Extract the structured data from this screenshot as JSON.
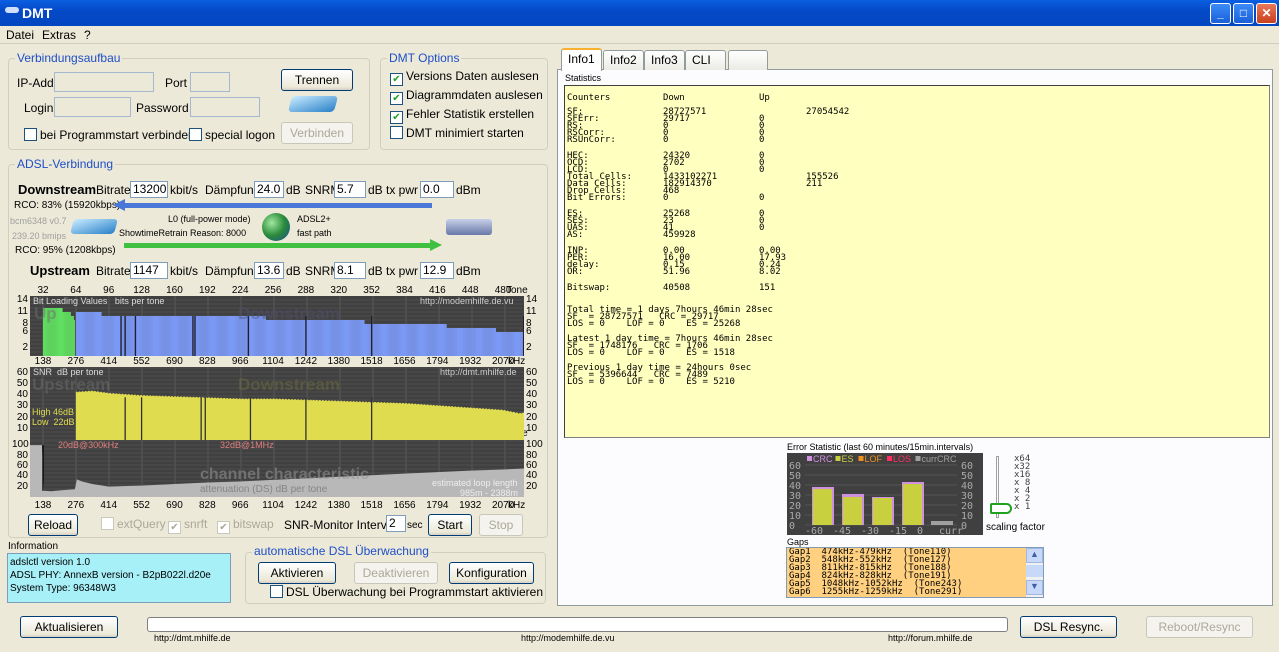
{
  "window": {
    "title": "DMT",
    "min": "_",
    "max": "□",
    "close": "✕"
  },
  "menu": [
    "Datei",
    "Extras",
    "?"
  ],
  "connection": {
    "group": "Verbindungsaufbau",
    "ip_label": "IP-Add.",
    "ip_value": "",
    "port_label": "Port",
    "port_value": "",
    "login_label": "Login",
    "login_value": "",
    "password_label": "Password",
    "password_value": "",
    "disconnect": "Trennen",
    "connect": "Verbinden",
    "autoconnect": "bei Programmstart verbinden",
    "autoconnect_checked": false,
    "special_logon": "special logon",
    "special_logon_checked": false
  },
  "dmt_options": {
    "group": "DMT Options",
    "items": [
      {
        "label": "Versions Daten auslesen",
        "checked": true
      },
      {
        "label": "Diagrammdaten auslesen",
        "checked": true
      },
      {
        "label": "Fehler Statistik erstellen",
        "checked": true
      },
      {
        "label": "DMT minimiert starten",
        "checked": false
      }
    ]
  },
  "adsl": {
    "group": "ADSL-Verbindung",
    "down": {
      "label": "Downstream",
      "bitrate_label": "Bitrate",
      "bitrate": "13200",
      "bitrate_unit": "kbit/s",
      "att_label": "Dämpfung",
      "att": "24.0",
      "att_unit": "dB",
      "snrm_label": "SNRM",
      "snrm": "5.7",
      "snrm_unit": "dB",
      "txpwr_label": "tx pwr",
      "txpwr": "0.0",
      "txpwr_unit": "dBm",
      "rco": "RCO: 83% (15920kbps)"
    },
    "up": {
      "label": "Upstream",
      "bitrate_label": "Bitrate",
      "bitrate": "1147",
      "bitrate_unit": "kbit/s",
      "att_label": "Dämpfung",
      "att": "13.6",
      "att_unit": "dB",
      "snrm_label": "SNRM",
      "snrm": "8.1",
      "snrm_unit": "dB",
      "txpwr_label": "tx pwr",
      "txpwr": "12.9",
      "txpwr_unit": "dBm",
      "rco": "RCO: 95% (1208kbps)"
    },
    "chip": "bcm6348 v0.7",
    "bmips": "239.20 bmips",
    "mode": "L0 (full-power mode)",
    "retrain": "ShowtimeRetrain Reason: 8000",
    "standard": "ADSL2+",
    "path": "fast path",
    "colors": {
      "down_arrow": "#4a78d8",
      "up_arrow": "#40c040"
    }
  },
  "chart_data": [
    {
      "type": "bar",
      "title": "Bit Loading Values   bits per tone",
      "watermark": "http://modemhilfe.de.vu",
      "bg_labels": [
        "Up",
        "Downstream"
      ],
      "tone_ticks": [
        32,
        64,
        96,
        128,
        160,
        192,
        224,
        256,
        288,
        320,
        352,
        384,
        416,
        448,
        480
      ],
      "tone_unit": "Tone",
      "khz_ticks": [
        138,
        276,
        414,
        552,
        690,
        828,
        966,
        1104,
        1242,
        1380,
        1518,
        1656,
        1794,
        1932,
        2070
      ],
      "khz_unit": "kHz",
      "y_ticks": [
        14,
        11,
        8,
        6,
        2
      ],
      "ylim": [
        0,
        15
      ],
      "series": [
        {
          "name": "Up",
          "color": "#60e060",
          "tones": [
            32,
            36,
            40,
            44,
            48,
            52,
            56,
            60,
            62
          ],
          "values": [
            12,
            12,
            12,
            12,
            12,
            11,
            11,
            10,
            9
          ]
        },
        {
          "name": "Downstream",
          "color": "#7b99f5",
          "tones": [
            64,
            80,
            96,
            112,
            128,
            144,
            160,
            176,
            192,
            208,
            224,
            240,
            256,
            272,
            288,
            304,
            320,
            336,
            352,
            368,
            384,
            400,
            416,
            432,
            448,
            464,
            480,
            496,
            511
          ],
          "values": [
            11,
            11,
            10,
            10,
            10,
            10,
            10,
            10,
            10,
            10,
            10,
            10,
            9,
            9,
            9,
            9,
            9,
            9,
            8,
            8,
            8,
            8,
            8,
            7,
            7,
            7,
            6,
            6,
            6
          ]
        }
      ],
      "dips": [
        108,
        112,
        122,
        178,
        180,
        232,
        288,
        352,
        500
      ]
    },
    {
      "type": "area",
      "title": "SNR  dB per tone",
      "watermark": "http://dmt.mhilfe.de",
      "bg_labels": [
        "Upstream",
        "Downstream"
      ],
      "high": "High 46dB",
      "low": "Low  22dB",
      "y_ticks": [
        60,
        50,
        40,
        30,
        20,
        10
      ],
      "ylim": [
        0,
        65
      ],
      "color": "#e0dc50",
      "tones": [
        64,
        80,
        96,
        112,
        128,
        160,
        192,
        224,
        256,
        288,
        320,
        352,
        384,
        416,
        448,
        480,
        496,
        511
      ],
      "values": [
        43,
        44,
        42,
        41,
        40,
        39,
        38,
        37,
        37,
        36,
        35,
        34,
        33,
        31,
        29,
        27,
        24,
        26
      ],
      "dips": [
        112,
        128,
        186,
        190,
        234,
        288,
        352
      ]
    },
    {
      "type": "area",
      "title": "channel characteristic",
      "subtitle": "attenuation (DS)  dB per tone",
      "note1": "20dB@300kHz",
      "note2": "32dB@1MHz",
      "loop_label": "estimated loop length",
      "loop_value": "985m - 2388m",
      "y_ticks": [
        100,
        80,
        60,
        40,
        20
      ],
      "ylim": [
        0,
        110
      ],
      "color": "#b8b8b8",
      "tones": [
        18,
        31,
        33,
        40,
        50,
        63,
        65,
        70,
        80,
        96,
        128,
        160,
        192,
        224,
        256,
        288,
        320,
        352,
        384,
        416,
        448,
        480,
        500
      ],
      "values": [
        100,
        100,
        12,
        11,
        13,
        15,
        34,
        30,
        25,
        20,
        22,
        25,
        28,
        30,
        33,
        36,
        39,
        42,
        45,
        48,
        51,
        53,
        55
      ]
    }
  ],
  "chart_controls": {
    "reload": "Reload",
    "extquery": "extQuery",
    "extquery_checked": false,
    "snrft": "snrft",
    "snrft_checked": true,
    "bitswap": "bitswap",
    "bitswap_checked": true,
    "interval_label": "SNR-Monitor Interval:",
    "interval": "2",
    "interval_unit": "sec",
    "start": "Start",
    "stop": "Stop"
  },
  "information": {
    "label": "Information",
    "lines": [
      "adslctl version 1.0",
      "ADSL PHY: AnnexB version - B2pB022l.d20e",
      "System Type: 96348W3"
    ]
  },
  "monitor": {
    "group": "automatische DSL Überwachung",
    "activate": "Aktivieren",
    "deactivate": "Deaktivieren",
    "config": "Konfiguration",
    "autostart": "DSL Überwachung bei Programmstart aktivieren",
    "autostart_checked": false
  },
  "tabs": [
    "Info1",
    "Info2",
    "Info3",
    "CLI",
    ""
  ],
  "statistics": {
    "label": "Statistics",
    "header": [
      "Counters",
      "Down",
      "Up",
      ""
    ],
    "groups": [
      [
        [
          "SF:",
          "28727571",
          "",
          "27054542"
        ],
        [
          "SFErr:",
          "29717",
          "0",
          ""
        ],
        [
          "RS:",
          "0",
          "0",
          ""
        ],
        [
          "RSCorr:",
          "0",
          "0",
          ""
        ],
        [
          "RSUnCorr:",
          "0",
          "0",
          ""
        ]
      ],
      [
        [
          "HEC:",
          "24320",
          "0",
          ""
        ],
        [
          "OCD:",
          "2702",
          "0",
          ""
        ],
        [
          "LCD:",
          "0",
          "0",
          ""
        ],
        [
          "Total Cells:",
          "1433102271",
          "",
          "155526"
        ],
        [
          "Data Cells:",
          "182914370",
          "",
          "211"
        ],
        [
          "Drop Cells:",
          "468",
          "",
          ""
        ],
        [
          "Bit Errors:",
          "0",
          "0",
          ""
        ]
      ],
      [
        [
          "ES:",
          "25268",
          "0",
          ""
        ],
        [
          "SES:",
          "23",
          "0",
          ""
        ],
        [
          "UAS:",
          "41",
          "0",
          ""
        ],
        [
          "AS:",
          "459928",
          "",
          ""
        ]
      ],
      [
        [
          "INP:",
          "0.00",
          "0.00",
          ""
        ],
        [
          "PER:",
          "16.00",
          "17.93",
          ""
        ],
        [
          "delay:",
          "0.15",
          "0.24",
          ""
        ],
        [
          "OR:",
          "51.96",
          "8.02",
          ""
        ]
      ],
      [
        [
          "Bitswap:",
          "40508",
          "151",
          ""
        ]
      ]
    ],
    "summaries": [
      [
        "Total time = 1 days 7hours 46min 28sec",
        "SF  = 28727571   CRC = 29717",
        "LOS = 0    LOF = 0    ES = 25268"
      ],
      [
        "Latest 1 day time = 7hours 46min 28sec",
        "SF  = 1748176   CRC = 1706",
        "LOS = 0    LOF = 0    ES = 1518"
      ],
      [
        "Previous 1 day time = 24hours 0sec",
        "SF  = 5396644   CRC = 7489",
        "LOS = 0    LOF = 0    ES = 5210"
      ]
    ]
  },
  "error_stat": {
    "title": "Error Statistic (last 60 minutes/15min.intervals)",
    "legend": [
      {
        "name": "CRC",
        "color": "#d090e0"
      },
      {
        "name": "ES",
        "color": "#c8d040"
      },
      {
        "name": "LOF",
        "color": "#f09020"
      },
      {
        "name": "LOS",
        "color": "#ff3060"
      },
      {
        "name": "currCRC",
        "color": "#a0a0a0"
      }
    ],
    "x_labels": [
      "-60",
      "-45",
      "-30",
      "-15",
      "0",
      "curr"
    ],
    "y_ticks": [
      60,
      50,
      40,
      30,
      20,
      10,
      0
    ],
    "ylim": [
      0,
      60
    ],
    "crc": [
      38,
      31,
      28,
      43
    ],
    "es": [
      36,
      28,
      27,
      41
    ],
    "curr_crc": 4,
    "scale_labels": [
      "x64",
      "x32",
      "x16",
      "x 8",
      "x 4",
      "x 2",
      "x 1"
    ],
    "scale_value": "x 1",
    "scale_caption": "scaling factor"
  },
  "gaps": {
    "label": "Gaps",
    "items": [
      "Gap1  474kHz-479kHz  (Tone110)",
      "Gap2  548kHz-552kHz  (Tone127)",
      "Gap3  811kHz-815kHz  (Tone188)",
      "Gap4  824kHz-828kHz  (Tone191)",
      "Gap5  1048kHz-1052kHz  (Tone243)",
      "Gap6  1255kHz-1259kHz  (Tone291)"
    ]
  },
  "bottom": {
    "refresh": "Aktualisieren",
    "progress": 0,
    "url1": "http://dmt.mhilfe.de",
    "url2": "http://modemhilfe.de.vu",
    "url3": "http://forum.mhilfe.de",
    "resync": "DSL Resync.",
    "reboot": "Reboot/Resync"
  }
}
